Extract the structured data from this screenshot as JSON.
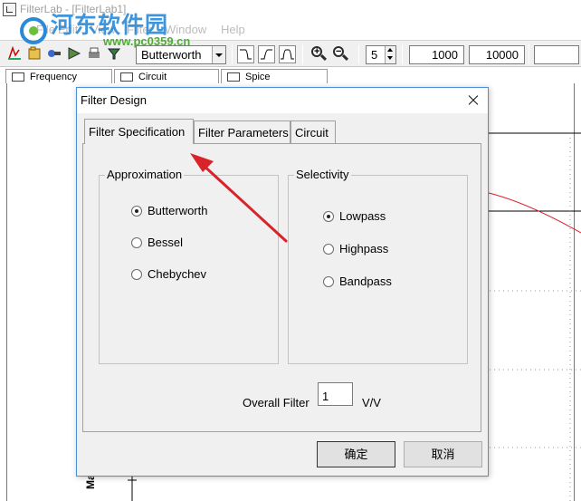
{
  "app": {
    "title": "FilterLab - [FilterLab1]",
    "menu": [
      "File",
      "Edit",
      "View",
      "Filter",
      "Window",
      "Help"
    ],
    "toolbar": {
      "approx_select": "Butterworth",
      "order_spin": "5",
      "freq_min": "1000",
      "freq_max": "10000"
    },
    "doc_tabs": [
      "Frequency",
      "Circuit",
      "Spice"
    ],
    "ylabel": "Magnitu"
  },
  "watermark": {
    "text": "河东软件园",
    "url": "www.pc0359.cn"
  },
  "dialog": {
    "title": "Filter Design",
    "tabs": [
      "Filter Specification",
      "Filter Parameters",
      "Circuit"
    ],
    "approximation": {
      "label": "Approximation",
      "options": [
        "Butterworth",
        "Bessel",
        "Chebychev"
      ],
      "selected": "Butterworth"
    },
    "selectivity": {
      "label": "Selectivity",
      "options": [
        "Lowpass",
        "Highpass",
        "Bandpass"
      ],
      "selected": "Lowpass"
    },
    "overall_filter": {
      "label": "Overall Filter",
      "value": "1",
      "unit": "V/V"
    },
    "buttons": {
      "ok": "确定",
      "cancel": "取消"
    }
  },
  "colors": {
    "annotation_arrow": "#d8232a",
    "dialog_border": "#4a90d9",
    "plot_curve": "#d8232a",
    "watermark_blue": "#2a8ad8",
    "watermark_green": "#49a82f"
  }
}
